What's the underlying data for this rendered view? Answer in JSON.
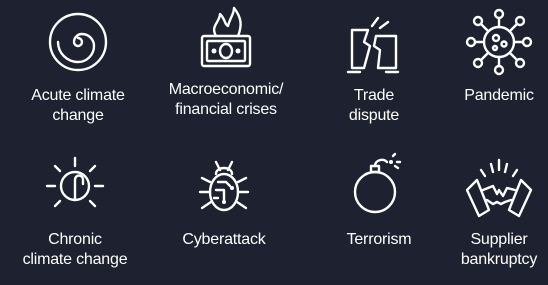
{
  "tiles": [
    {
      "icon": "spiral-icon",
      "label_lines": [
        "Acute climate",
        "change"
      ]
    },
    {
      "icon": "burning-banknote-icon",
      "label_lines": [
        "Macroeconomic/",
        "financial crises"
      ]
    },
    {
      "icon": "broken-box-icon",
      "label_lines": [
        "Trade",
        "dispute"
      ]
    },
    {
      "icon": "virus-icon",
      "label_lines": [
        "Pandemic"
      ]
    },
    {
      "icon": "wilting-sun-icon",
      "label_lines": [
        "Chronic",
        "climate change"
      ]
    },
    {
      "icon": "bug-circuit-icon",
      "label_lines": [
        "Cyberattack"
      ]
    },
    {
      "icon": "bomb-icon",
      "label_lines": [
        "Terrorism"
      ]
    },
    {
      "icon": "broken-handshake-icon",
      "label_lines": [
        "Supplier",
        "bankruptcy"
      ]
    }
  ]
}
